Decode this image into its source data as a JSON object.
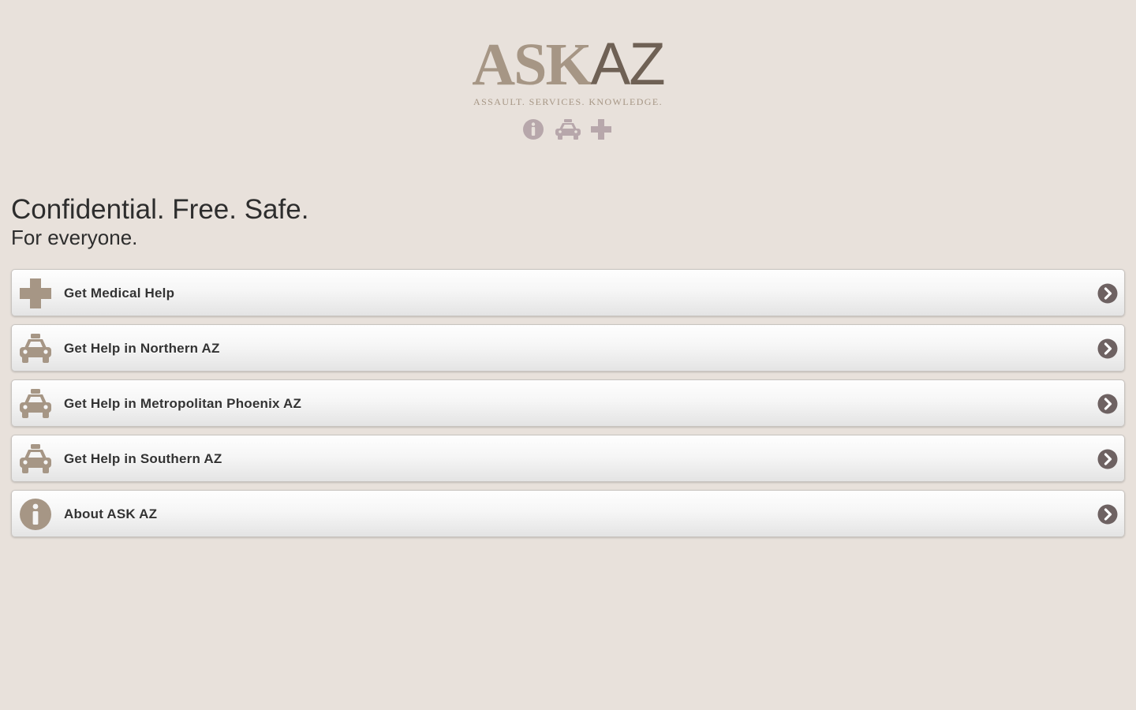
{
  "brand": {
    "logo_ask": "ASK",
    "logo_az": "AZ",
    "tagline": "ASSAULT. SERVICES. KNOWLEDGE.",
    "header_icons": [
      "info-icon",
      "taxi-icon",
      "medical-cross-icon"
    ]
  },
  "intro": {
    "headline": "Confidential. Free. Safe.",
    "subhead": "For everyone."
  },
  "menu": {
    "items": [
      {
        "label": "Get Medical Help",
        "icon": "medical-cross-icon"
      },
      {
        "label": "Get Help in Northern AZ",
        "icon": "taxi-icon"
      },
      {
        "label": "Get Help in Metropolitan Phoenix AZ",
        "icon": "taxi-icon"
      },
      {
        "label": "Get Help in Southern AZ",
        "icon": "taxi-icon"
      },
      {
        "label": "About ASK AZ",
        "icon": "info-icon"
      }
    ]
  },
  "colors": {
    "background": "#e8e1db",
    "brand_light": "#a69685",
    "brand_dark": "#6f6155",
    "icon_brown": "#a69685",
    "header_icon_mauve": "#b7a7ab",
    "chevron": "#6e6262",
    "text": "#333333"
  }
}
